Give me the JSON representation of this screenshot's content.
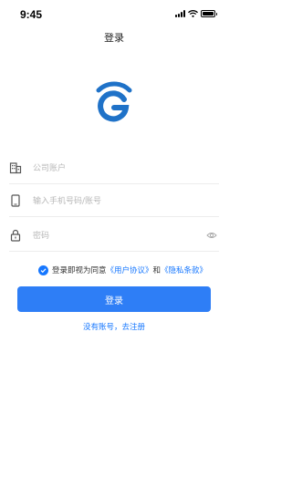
{
  "status_bar": {
    "time": "9:45"
  },
  "header": {
    "title": "登录"
  },
  "form": {
    "company_account": {
      "placeholder": "公司账户",
      "icon": "building-icon"
    },
    "phone_account": {
      "placeholder": "输入手机号码/账号",
      "icon": "phone-icon"
    },
    "password": {
      "placeholder": "密码",
      "icon": "lock-icon",
      "toggle_icon": "eye-icon"
    }
  },
  "agreement": {
    "checked": true,
    "prefix": "登录即视为同意",
    "user_agreement": "《用户协议》",
    "and": "和",
    "privacy_policy": "《隐私条款》"
  },
  "actions": {
    "login_label": "登录",
    "register_label": "没有账号，去注册"
  },
  "colors": {
    "accent": "#1677ff",
    "button": "#2e7ef6",
    "logo": "#1f72c8"
  }
}
